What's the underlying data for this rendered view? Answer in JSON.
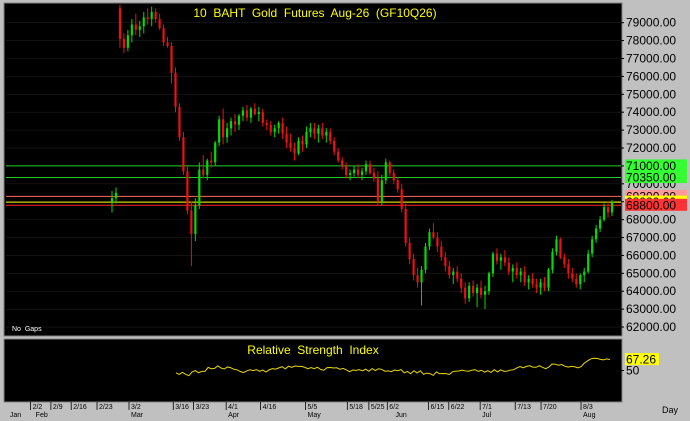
{
  "chart_data": [
    {
      "type": "candlestick",
      "title": "10  BAHT  Gold  Futures  Aug-26  (GF10Q26)",
      "note": "No  Gaps",
      "ylim": [
        61500,
        80100
      ],
      "y_ticks": [
        "79000.00",
        "78000.00",
        "77000.00",
        "76000.00",
        "75000.00",
        "74000.00",
        "73000.00",
        "72000.00",
        "71000.00",
        "70000.00",
        "69000.00",
        "68000.00",
        "67000.00",
        "66000.00",
        "65000.00",
        "64000.00",
        "63000.00",
        "62000.00"
      ],
      "levels": [
        {
          "value": 71000,
          "label": "71000.00",
          "line_color": "#22cc22",
          "box_color": "#33ff33"
        },
        {
          "value": 70350,
          "label": "70350.00",
          "line_color": "#22cc22",
          "box_color": "#33ff33"
        },
        {
          "value": 69300,
          "label": "69300.00",
          "line_color": "#ff6666",
          "box_color": "#ff9999"
        },
        {
          "value": 68980,
          "label": "68980.00",
          "line_color": "#ffff00",
          "box_color": "#ffff00"
        },
        {
          "value": 68800,
          "label": "68800.00",
          "line_color": "#ff2222",
          "box_color": "#ff3333"
        }
      ],
      "colors": {
        "up": "#00dd00",
        "down": "#ee1111",
        "background": "#000000"
      },
      "candles": [
        [
          69000,
          69600,
          68400,
          69200
        ],
        [
          69200,
          69800,
          68900,
          69500
        ],
        [
          79800,
          80000,
          77600,
          78100
        ],
        [
          78100,
          78400,
          77300,
          77600
        ],
        [
          77600,
          78600,
          77400,
          78300
        ],
        [
          78300,
          79200,
          77900,
          78900
        ],
        [
          78900,
          79500,
          78300,
          78600
        ],
        [
          78600,
          79100,
          78200,
          78800
        ],
        [
          78800,
          79600,
          78400,
          79300
        ],
        [
          79300,
          79800,
          78900,
          79200
        ],
        [
          79200,
          79900,
          78800,
          79600
        ],
        [
          79600,
          79800,
          79000,
          79200
        ],
        [
          79200,
          79500,
          78600,
          78700
        ],
        [
          78700,
          78900,
          77700,
          77900
        ],
        [
          77900,
          78200,
          77600,
          77700
        ],
        [
          77700,
          77900,
          75600,
          76200
        ],
        [
          76200,
          76500,
          74000,
          74300
        ],
        [
          74300,
          74500,
          72400,
          72600
        ],
        [
          72600,
          72900,
          70500,
          70700
        ],
        [
          70700,
          71000,
          68300,
          68500
        ],
        [
          68500,
          69000,
          65400,
          67200
        ],
        [
          67200,
          69200,
          66800,
          68800
        ],
        [
          68800,
          71200,
          68600,
          70800
        ],
        [
          70800,
          71600,
          70300,
          70500
        ],
        [
          70500,
          71400,
          70200,
          71300
        ],
        [
          71300,
          71800,
          70900,
          71200
        ],
        [
          71200,
          72400,
          71000,
          72300
        ],
        [
          72300,
          73800,
          72100,
          73600
        ],
        [
          73600,
          74200,
          72200,
          72600
        ],
        [
          72600,
          73400,
          72300,
          73100
        ],
        [
          73100,
          73700,
          72700,
          73500
        ],
        [
          73500,
          73900,
          72900,
          73300
        ],
        [
          73300,
          73900,
          73000,
          73800
        ],
        [
          73800,
          74300,
          73500,
          74100
        ],
        [
          74100,
          74400,
          73500,
          73700
        ],
        [
          73700,
          74300,
          73400,
          74200
        ],
        [
          74200,
          74500,
          73800,
          73900
        ],
        [
          73900,
          74300,
          73500,
          74000
        ],
        [
          74000,
          74200,
          73200,
          73400
        ],
        [
          73400,
          73600,
          73000,
          73300
        ],
        [
          73300,
          73500,
          72700,
          72900
        ],
        [
          72900,
          73300,
          72600,
          73100
        ],
        [
          73100,
          73500,
          72800,
          73400
        ],
        [
          73400,
          73700,
          72500,
          72800
        ],
        [
          72800,
          73200,
          72000,
          72300
        ],
        [
          72300,
          72800,
          71800,
          72000
        ],
        [
          72000,
          72300,
          71300,
          71700
        ],
        [
          71700,
          72600,
          71600,
          72400
        ],
        [
          72400,
          72700,
          71800,
          72200
        ],
        [
          72200,
          73200,
          72000,
          72900
        ],
        [
          72900,
          73400,
          72600,
          73100
        ],
        [
          73100,
          73400,
          72500,
          72800
        ],
        [
          72800,
          73300,
          72300,
          73100
        ],
        [
          73100,
          73400,
          72500,
          72700
        ],
        [
          72700,
          73100,
          72300,
          72900
        ],
        [
          72900,
          73100,
          72200,
          72400
        ],
        [
          72400,
          72600,
          71600,
          71800
        ],
        [
          71800,
          72000,
          71200,
          71300
        ],
        [
          71300,
          71500,
          70800,
          71000
        ],
        [
          71000,
          71200,
          70300,
          70500
        ],
        [
          70500,
          70800,
          70200,
          70600
        ],
        [
          70600,
          71000,
          70400,
          70800
        ],
        [
          70800,
          71100,
          70300,
          70500
        ],
        [
          70500,
          70900,
          70200,
          70700
        ],
        [
          70700,
          71300,
          70500,
          71100
        ],
        [
          71100,
          71300,
          70500,
          70600
        ],
        [
          70600,
          70900,
          70100,
          70300
        ],
        [
          70300,
          70700,
          68800,
          69000
        ],
        [
          69000,
          70500,
          68800,
          70200
        ],
        [
          70200,
          71400,
          70000,
          71200
        ],
        [
          71200,
          71300,
          70400,
          70600
        ],
        [
          70600,
          70800,
          70000,
          70200
        ],
        [
          70200,
          70400,
          69500,
          69700
        ],
        [
          69700,
          70000,
          68400,
          68600
        ],
        [
          68600,
          68900,
          66500,
          66700
        ],
        [
          66700,
          67000,
          65500,
          65800
        ],
        [
          65800,
          66100,
          64600,
          64900
        ],
        [
          64900,
          65300,
          64200,
          64500
        ],
        [
          64500,
          65400,
          63200,
          65200
        ],
        [
          65200,
          66700,
          65000,
          66500
        ],
        [
          66500,
          67500,
          66300,
          67300
        ],
        [
          67300,
          67800,
          66900,
          67000
        ],
        [
          67000,
          67300,
          66200,
          66500
        ],
        [
          66500,
          66800,
          65700,
          65900
        ],
        [
          65900,
          66200,
          65100,
          65400
        ],
        [
          65400,
          65700,
          64700,
          64900
        ],
        [
          64900,
          65300,
          64400,
          65100
        ],
        [
          65100,
          65400,
          64500,
          64700
        ],
        [
          64700,
          65000,
          63900,
          64200
        ],
        [
          64200,
          64500,
          63300,
          63600
        ],
        [
          63600,
          64500,
          63400,
          64300
        ],
        [
          64300,
          64600,
          63700,
          63900
        ],
        [
          63900,
          64400,
          63100,
          64200
        ],
        [
          64200,
          64600,
          63600,
          63800
        ],
        [
          63800,
          64300,
          63000,
          64000
        ],
        [
          64000,
          65100,
          63800,
          65000
        ],
        [
          65000,
          66200,
          64800,
          66100
        ],
        [
          66100,
          66400,
          65500,
          65700
        ],
        [
          65700,
          66100,
          65200,
          65900
        ],
        [
          65900,
          66300,
          65400,
          65600
        ],
        [
          65600,
          65900,
          64900,
          65100
        ],
        [
          65100,
          65500,
          64500,
          65300
        ],
        [
          65300,
          65600,
          64700,
          64900
        ],
        [
          64900,
          65300,
          64500,
          65100
        ],
        [
          65100,
          65400,
          64300,
          64500
        ],
        [
          64500,
          64900,
          64100,
          64700
        ],
        [
          64700,
          65000,
          64200,
          64400
        ],
        [
          64400,
          64700,
          63900,
          64200
        ],
        [
          64200,
          64700,
          63800,
          64500
        ],
        [
          64500,
          64800,
          64000,
          64200
        ],
        [
          64200,
          65300,
          64000,
          65200
        ],
        [
          65200,
          66400,
          65000,
          66200
        ],
        [
          66200,
          67100,
          66000,
          66900
        ],
        [
          66900,
          67000,
          65800,
          65900
        ],
        [
          65900,
          66100,
          65300,
          65500
        ],
        [
          65500,
          65800,
          64700,
          65000
        ],
        [
          65000,
          65300,
          64500,
          64700
        ],
        [
          64700,
          65000,
          64200,
          64400
        ],
        [
          64400,
          65000,
          64100,
          64900
        ],
        [
          64900,
          65300,
          64500,
          65100
        ],
        [
          65100,
          66300,
          65000,
          66100
        ],
        [
          66100,
          67100,
          65900,
          66900
        ],
        [
          66900,
          67700,
          66700,
          67500
        ],
        [
          67500,
          68200,
          67300,
          68000
        ],
        [
          68000,
          68900,
          67900,
          68700
        ],
        [
          68700,
          69000,
          68100,
          68400
        ],
        [
          68400,
          69100,
          68200,
          68980
        ]
      ]
    },
    {
      "type": "line",
      "title": "Relative  Strength  Index",
      "ylim": [
        0,
        100
      ],
      "y_ticks": [
        "50"
      ],
      "last_value": "67.26",
      "line_color": "#e8d800",
      "values": [
        46.4,
        43.7,
        47.1,
        43.9,
        41.8,
        47.7,
        49.9,
        46.3,
        48.6,
        48.7,
        54.9,
        52.8,
        53.4,
        57.4,
        53.9,
        52.4,
        55.6,
        54.4,
        51.9,
        51.1,
        48.4,
        46.7,
        49.3,
        51.2,
        49.8,
        51.4,
        48.7,
        50.7,
        47.5,
        51.2,
        53.0,
        52.2,
        54.2,
        56.0,
        52.5,
        56.8,
        55.0,
        57.1,
        56.5,
        56.6,
        55.2,
        52.6,
        54.8,
        52.8,
        55.2,
        51.6,
        50.4,
        54.5,
        54.8,
        53.9,
        54.3,
        51.9,
        53.3,
        50.9,
        48.1,
        50.8,
        50.2,
        51.3,
        49.5,
        52.0,
        48.8,
        53.0,
        50.0,
        52.8,
        51.7,
        48.9,
        49.4,
        48.2,
        50.7,
        49.6,
        51.5,
        46.2,
        48.5,
        44.8,
        49.6,
        46.1,
        49.6,
        44.0,
        45.9,
        45.1,
        42.2,
        47.8,
        44.8,
        45.3,
        45.1,
        43.7,
        47.9,
        49.0,
        49.2,
        50.6,
        49.3,
        48.9,
        50.4,
        51.3,
        48.6,
        50.4,
        47.4,
        49.7,
        47.0,
        51.3,
        47.7,
        51.1,
        48.6,
        49.1,
        50.7,
        51.1,
        54.1,
        56.3,
        54.2,
        56.5,
        57.5,
        55.4,
        55.1,
        57.6,
        55.0,
        52.9,
        55.7,
        60.3,
        60.0,
        58.4,
        59.5,
        56.6,
        55.3,
        56.6,
        56.0,
        54.2,
        56.1,
        61.7,
        65.2,
        68.4,
        69.5,
        69.3,
        67.7,
        66.8,
        68.4,
        67.3
      ]
    }
  ],
  "x_ticks": [
    {
      "label": "2/2",
      "pos": 0.04
    },
    {
      "label": "2/9",
      "pos": 0.073
    },
    {
      "label": "2/16",
      "pos": 0.106
    },
    {
      "label": "2/23",
      "pos": 0.148
    },
    {
      "label": "3/2",
      "pos": 0.2
    },
    {
      "label": "3/16",
      "pos": 0.272
    },
    {
      "label": "3/23",
      "pos": 0.305
    },
    {
      "label": "4/1",
      "pos": 0.358
    },
    {
      "label": "4/16",
      "pos": 0.414
    },
    {
      "label": "5/5",
      "pos": 0.487
    },
    {
      "label": "5/18",
      "pos": 0.555
    },
    {
      "label": "5/25",
      "pos": 0.59
    },
    {
      "label": "6/2",
      "pos": 0.62
    },
    {
      "label": "6/15",
      "pos": 0.687
    },
    {
      "label": "6/22",
      "pos": 0.72
    },
    {
      "label": "7/1",
      "pos": 0.771
    },
    {
      "label": "7/13",
      "pos": 0.828
    },
    {
      "label": "7/20",
      "pos": 0.87
    },
    {
      "label": "8/3",
      "pos": 0.935
    }
  ],
  "x_months": [
    {
      "label": "Jan",
      "pos": 0.003
    },
    {
      "label": "Feb",
      "pos": 0.045
    },
    {
      "label": "Mar",
      "pos": 0.2
    },
    {
      "label": "Apr",
      "pos": 0.358
    },
    {
      "label": "May",
      "pos": 0.487
    },
    {
      "label": "Jun",
      "pos": 0.63
    },
    {
      "label": "Jul",
      "pos": 0.771
    },
    {
      "label": "Aug",
      "pos": 0.935
    }
  ],
  "x_unit": "Day"
}
